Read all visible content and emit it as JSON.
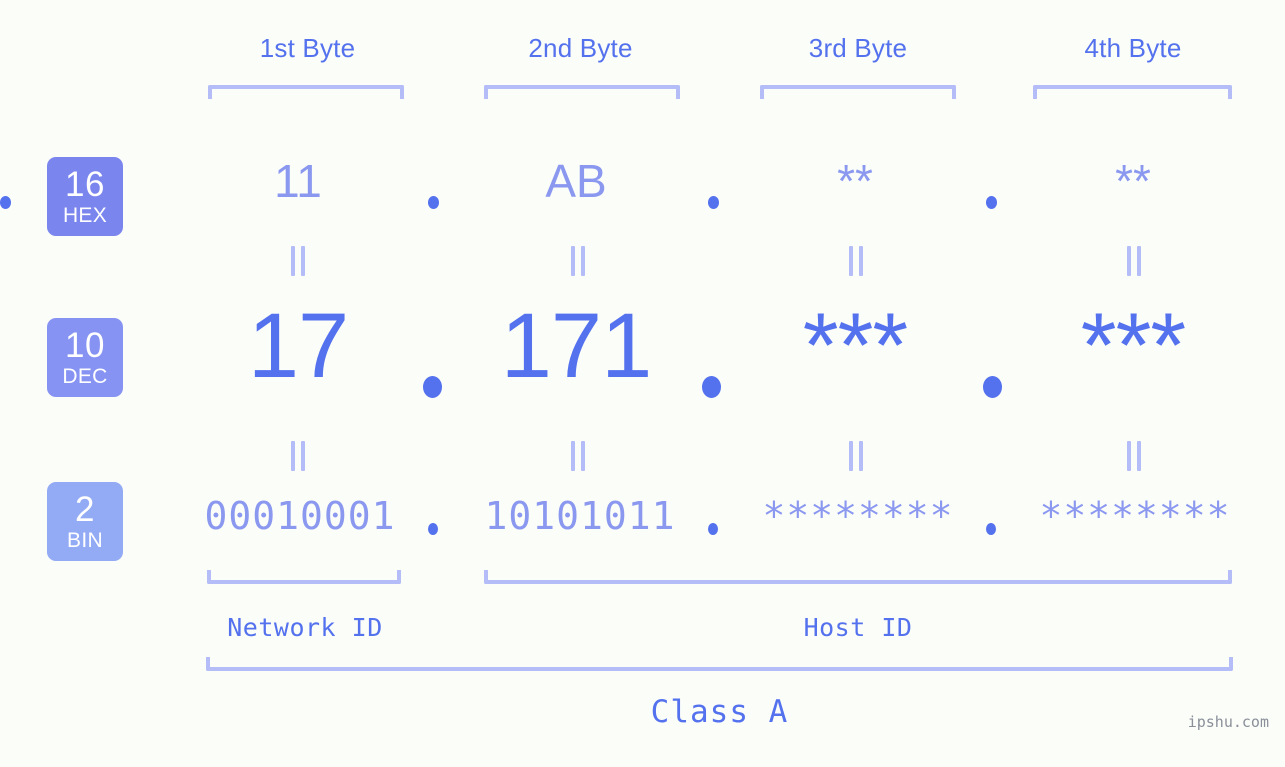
{
  "background_color": "#fbfdf8",
  "accent_color": "#5471ee",
  "light_accent_color": "#8b98f0",
  "bracket_color": "#b4bdf7",
  "byte_headers": [
    {
      "label": "1st Byte"
    },
    {
      "label": "2nd Byte"
    },
    {
      "label": "3rd Byte"
    },
    {
      "label": "4th Byte"
    }
  ],
  "rows": {
    "hex": {
      "badge_number": "16",
      "badge_abbr": "HEX",
      "values": [
        "11",
        "AB",
        "**",
        "**"
      ],
      "separators": [
        ".",
        ".",
        "."
      ]
    },
    "dec": {
      "badge_number": "10",
      "badge_abbr": "DEC",
      "values": [
        "17",
        "171",
        "***",
        "***"
      ],
      "separators": [
        ".",
        ".",
        "."
      ]
    },
    "bin": {
      "badge_number": "2",
      "badge_abbr": "BIN",
      "values": [
        "00010001",
        "10101011",
        "********",
        "********"
      ],
      "separators": [
        ".",
        ".",
        "."
      ]
    }
  },
  "equality_marks": {
    "symbol": "=",
    "rotated": true,
    "count_per_gap": 4
  },
  "id_labels": {
    "network": "Network ID",
    "host": "Host ID"
  },
  "class_label": "Class A",
  "watermark": "ipshu.com"
}
